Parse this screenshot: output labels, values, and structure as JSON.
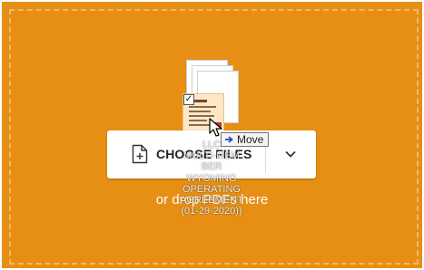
{
  "dropzone": {
    "background_color": "#e68f14",
    "border_color": "#f4b56a",
    "choose_button": {
      "label": "CHOOSE FILES",
      "icon": "file-plus-icon",
      "dropdown_icon": "chevron-down-icon"
    },
    "drop_hint": "or drop PDFs here",
    "dragged_file": {
      "name": "LLC\nMULTI-MEM\nBER\nWYOMING\nOPERATING\nAGREEMENT\n(01-29-2020))",
      "icon": "document-thumbnail-icon"
    },
    "drag_tooltip": {
      "label": "Move",
      "icon": "move-arrow-icon"
    }
  }
}
